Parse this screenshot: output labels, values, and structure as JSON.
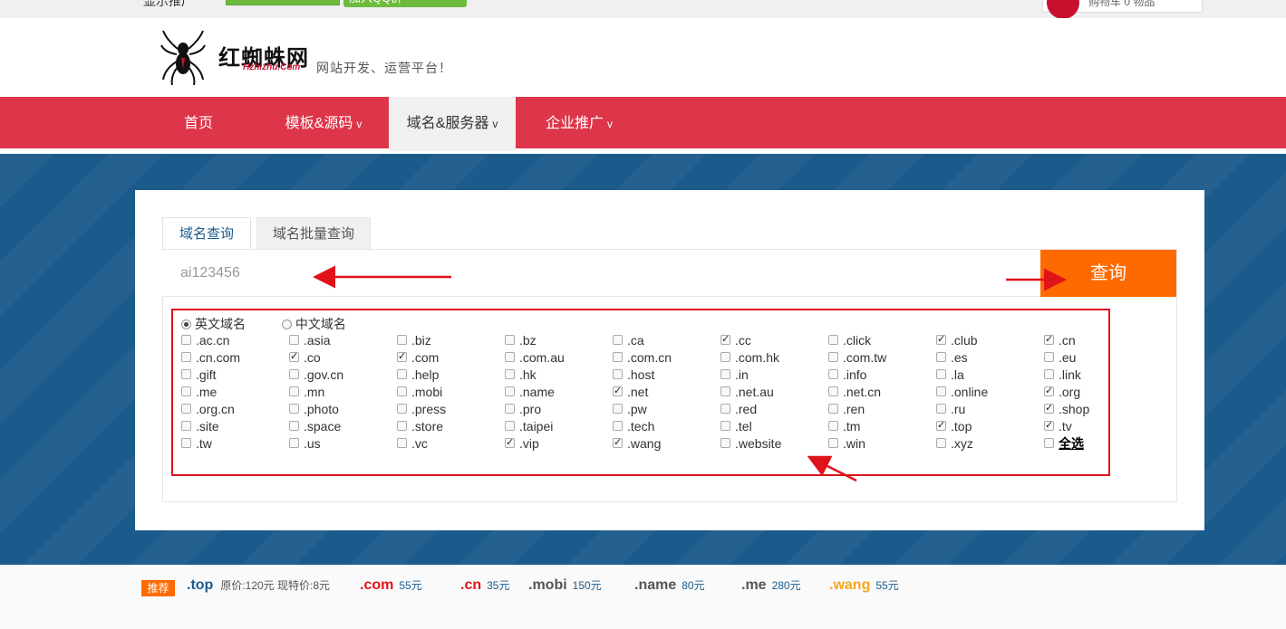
{
  "topbar": {
    "left_text": "显示推广",
    "qq_group": "加入QQ群",
    "cart": "购物车 0 物品"
  },
  "header": {
    "brand": "红蜘蛛网",
    "brand_sub": "Hzhizhu.Com",
    "slogan": "网站开发、运营平台！"
  },
  "nav": [
    {
      "label": "首页",
      "arrow": ""
    },
    {
      "label": "模板&源码",
      "arrow": "v"
    },
    {
      "label": "域名&服务器",
      "arrow": "v"
    },
    {
      "label": "企业推广",
      "arrow": "v"
    }
  ],
  "tabs": [
    "域名查询",
    "域名批量查询"
  ],
  "search": {
    "value": "ai123456",
    "button": "查询"
  },
  "radios": [
    {
      "label": "英文域名",
      "checked": true
    },
    {
      "label": "中文域名",
      "checked": false
    }
  ],
  "tlds": [
    [
      ".ac.cn",
      false
    ],
    [
      ".asia",
      false
    ],
    [
      ".biz",
      false
    ],
    [
      ".bz",
      false
    ],
    [
      ".ca",
      false
    ],
    [
      ".cc",
      true
    ],
    [
      ".click",
      false
    ],
    [
      ".club",
      true
    ],
    [
      ".cn",
      true
    ],
    [
      ".cn.com",
      false
    ],
    [
      ".co",
      true
    ],
    [
      ".com",
      true
    ],
    [
      ".com.au",
      false
    ],
    [
      ".com.cn",
      false
    ],
    [
      ".com.hk",
      false
    ],
    [
      ".com.tw",
      false
    ],
    [
      ".es",
      false
    ],
    [
      ".eu",
      false
    ],
    [
      ".gift",
      false
    ],
    [
      ".gov.cn",
      false
    ],
    [
      ".help",
      false
    ],
    [
      ".hk",
      false
    ],
    [
      ".host",
      false
    ],
    [
      ".in",
      false
    ],
    [
      ".info",
      false
    ],
    [
      ".la",
      false
    ],
    [
      ".link",
      false
    ],
    [
      ".me",
      false
    ],
    [
      ".mn",
      false
    ],
    [
      ".mobi",
      false
    ],
    [
      ".name",
      false
    ],
    [
      ".net",
      true
    ],
    [
      ".net.au",
      false
    ],
    [
      ".net.cn",
      false
    ],
    [
      ".online",
      false
    ],
    [
      ".org",
      true
    ],
    [
      ".org.cn",
      false
    ],
    [
      ".photo",
      false
    ],
    [
      ".press",
      false
    ],
    [
      ".pro",
      false
    ],
    [
      ".pw",
      false
    ],
    [
      ".red",
      false
    ],
    [
      ".ren",
      false
    ],
    [
      ".ru",
      false
    ],
    [
      ".shop",
      true
    ],
    [
      ".site",
      false
    ],
    [
      ".space",
      false
    ],
    [
      ".store",
      false
    ],
    [
      ".taipei",
      false
    ],
    [
      ".tech",
      false
    ],
    [
      ".tel",
      false
    ],
    [
      ".tm",
      false
    ],
    [
      ".top",
      true
    ],
    [
      ".tv",
      true
    ],
    [
      ".tw",
      false
    ],
    [
      ".us",
      false
    ],
    [
      ".vc",
      false
    ],
    [
      ".vip",
      true
    ],
    [
      ".wang",
      true
    ],
    [
      ".website",
      false
    ],
    [
      ".win",
      false
    ],
    [
      ".xyz",
      false
    ],
    [
      "全选",
      false
    ]
  ],
  "promo": {
    "tag": "推荐",
    "items": [
      {
        "name": ".top",
        "price": "",
        "orig": "原价:120元  现特价:8元",
        "color": "#1b5b8c"
      },
      {
        "name": ".com",
        "price": "55元",
        "orig": "",
        "color": "#e0121a"
      },
      {
        "name": ".cn",
        "price": "35元",
        "orig": "",
        "color": "#e0121a"
      },
      {
        "name": ".mobi",
        "price": "150元",
        "orig": "",
        "color": "#555555"
      },
      {
        "name": ".name",
        "price": "80元",
        "orig": "",
        "color": "#555555"
      },
      {
        "name": ".me",
        "price": "280元",
        "orig": "",
        "color": "#555555"
      },
      {
        "name": ".wang",
        "price": "55元",
        "orig": "",
        "color": "#f5a623"
      }
    ]
  },
  "colors": {
    "nav": "#dd3549",
    "accent": "#ff6a00",
    "banner": "#1b5b8c",
    "annotation": "#e0121a"
  }
}
